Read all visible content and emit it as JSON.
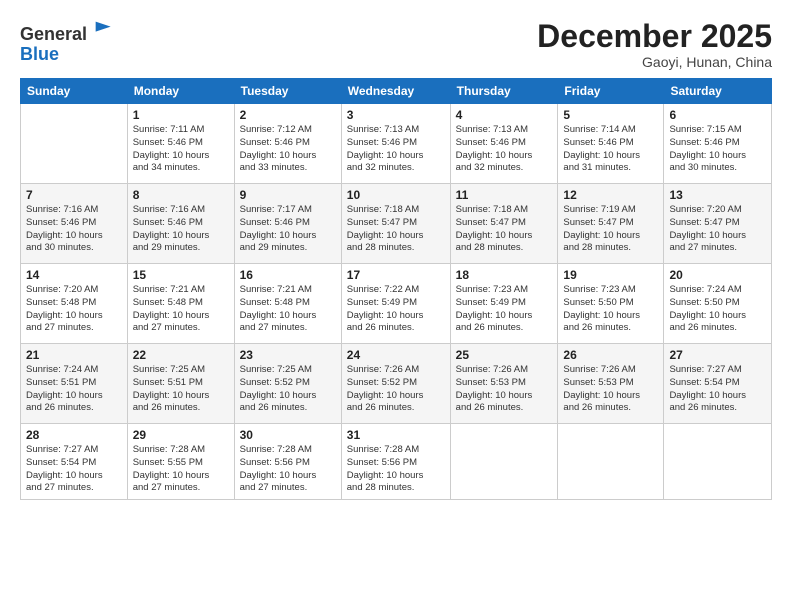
{
  "header": {
    "logo_line1": "General",
    "logo_line2": "Blue",
    "month": "December 2025",
    "location": "Gaoyi, Hunan, China"
  },
  "weekdays": [
    "Sunday",
    "Monday",
    "Tuesday",
    "Wednesday",
    "Thursday",
    "Friday",
    "Saturday"
  ],
  "weeks": [
    [
      {
        "day": "",
        "info": ""
      },
      {
        "day": "1",
        "info": "Sunrise: 7:11 AM\nSunset: 5:46 PM\nDaylight: 10 hours\nand 34 minutes."
      },
      {
        "day": "2",
        "info": "Sunrise: 7:12 AM\nSunset: 5:46 PM\nDaylight: 10 hours\nand 33 minutes."
      },
      {
        "day": "3",
        "info": "Sunrise: 7:13 AM\nSunset: 5:46 PM\nDaylight: 10 hours\nand 32 minutes."
      },
      {
        "day": "4",
        "info": "Sunrise: 7:13 AM\nSunset: 5:46 PM\nDaylight: 10 hours\nand 32 minutes."
      },
      {
        "day": "5",
        "info": "Sunrise: 7:14 AM\nSunset: 5:46 PM\nDaylight: 10 hours\nand 31 minutes."
      },
      {
        "day": "6",
        "info": "Sunrise: 7:15 AM\nSunset: 5:46 PM\nDaylight: 10 hours\nand 30 minutes."
      }
    ],
    [
      {
        "day": "7",
        "info": "Sunrise: 7:16 AM\nSunset: 5:46 PM\nDaylight: 10 hours\nand 30 minutes."
      },
      {
        "day": "8",
        "info": "Sunrise: 7:16 AM\nSunset: 5:46 PM\nDaylight: 10 hours\nand 29 minutes."
      },
      {
        "day": "9",
        "info": "Sunrise: 7:17 AM\nSunset: 5:46 PM\nDaylight: 10 hours\nand 29 minutes."
      },
      {
        "day": "10",
        "info": "Sunrise: 7:18 AM\nSunset: 5:47 PM\nDaylight: 10 hours\nand 28 minutes."
      },
      {
        "day": "11",
        "info": "Sunrise: 7:18 AM\nSunset: 5:47 PM\nDaylight: 10 hours\nand 28 minutes."
      },
      {
        "day": "12",
        "info": "Sunrise: 7:19 AM\nSunset: 5:47 PM\nDaylight: 10 hours\nand 28 minutes."
      },
      {
        "day": "13",
        "info": "Sunrise: 7:20 AM\nSunset: 5:47 PM\nDaylight: 10 hours\nand 27 minutes."
      }
    ],
    [
      {
        "day": "14",
        "info": "Sunrise: 7:20 AM\nSunset: 5:48 PM\nDaylight: 10 hours\nand 27 minutes."
      },
      {
        "day": "15",
        "info": "Sunrise: 7:21 AM\nSunset: 5:48 PM\nDaylight: 10 hours\nand 27 minutes."
      },
      {
        "day": "16",
        "info": "Sunrise: 7:21 AM\nSunset: 5:48 PM\nDaylight: 10 hours\nand 27 minutes."
      },
      {
        "day": "17",
        "info": "Sunrise: 7:22 AM\nSunset: 5:49 PM\nDaylight: 10 hours\nand 26 minutes."
      },
      {
        "day": "18",
        "info": "Sunrise: 7:23 AM\nSunset: 5:49 PM\nDaylight: 10 hours\nand 26 minutes."
      },
      {
        "day": "19",
        "info": "Sunrise: 7:23 AM\nSunset: 5:50 PM\nDaylight: 10 hours\nand 26 minutes."
      },
      {
        "day": "20",
        "info": "Sunrise: 7:24 AM\nSunset: 5:50 PM\nDaylight: 10 hours\nand 26 minutes."
      }
    ],
    [
      {
        "day": "21",
        "info": "Sunrise: 7:24 AM\nSunset: 5:51 PM\nDaylight: 10 hours\nand 26 minutes."
      },
      {
        "day": "22",
        "info": "Sunrise: 7:25 AM\nSunset: 5:51 PM\nDaylight: 10 hours\nand 26 minutes."
      },
      {
        "day": "23",
        "info": "Sunrise: 7:25 AM\nSunset: 5:52 PM\nDaylight: 10 hours\nand 26 minutes."
      },
      {
        "day": "24",
        "info": "Sunrise: 7:26 AM\nSunset: 5:52 PM\nDaylight: 10 hours\nand 26 minutes."
      },
      {
        "day": "25",
        "info": "Sunrise: 7:26 AM\nSunset: 5:53 PM\nDaylight: 10 hours\nand 26 minutes."
      },
      {
        "day": "26",
        "info": "Sunrise: 7:26 AM\nSunset: 5:53 PM\nDaylight: 10 hours\nand 26 minutes."
      },
      {
        "day": "27",
        "info": "Sunrise: 7:27 AM\nSunset: 5:54 PM\nDaylight: 10 hours\nand 26 minutes."
      }
    ],
    [
      {
        "day": "28",
        "info": "Sunrise: 7:27 AM\nSunset: 5:54 PM\nDaylight: 10 hours\nand 27 minutes."
      },
      {
        "day": "29",
        "info": "Sunrise: 7:28 AM\nSunset: 5:55 PM\nDaylight: 10 hours\nand 27 minutes."
      },
      {
        "day": "30",
        "info": "Sunrise: 7:28 AM\nSunset: 5:56 PM\nDaylight: 10 hours\nand 27 minutes."
      },
      {
        "day": "31",
        "info": "Sunrise: 7:28 AM\nSunset: 5:56 PM\nDaylight: 10 hours\nand 28 minutes."
      },
      {
        "day": "",
        "info": ""
      },
      {
        "day": "",
        "info": ""
      },
      {
        "day": "",
        "info": ""
      }
    ]
  ]
}
